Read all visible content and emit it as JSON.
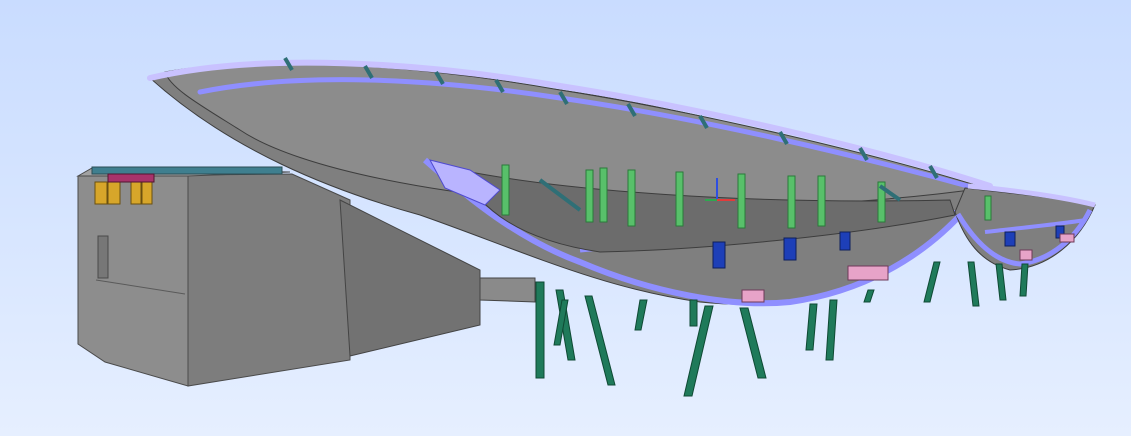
{
  "viewport": {
    "background_top": "#c9dcff",
    "background_bottom": "#e6efff"
  },
  "model": {
    "description_visible": false,
    "colors": {
      "concrete": "#8e8e8e",
      "concrete_dark": "#6f6f6f",
      "concrete_light": "#a3a3a3",
      "edge_band": "#8f8fff",
      "edge_band_light": "#c9c2ff",
      "steel_pile": "#1f7a5a",
      "steel_pile_light": "#58c06a",
      "brace": "#2f6f76",
      "accent_blue": "#1d3fb8",
      "accent_pink": "#e7a3c8",
      "accent_yellow": "#d7a62a",
      "accent_magenta": "#a8336b",
      "roof_strip": "#3f7f8f"
    }
  },
  "gizmo": {
    "x_axis_color": "#e23b3b",
    "y_axis_color": "#2ea84f",
    "z_axis_color": "#2e4fe2"
  }
}
